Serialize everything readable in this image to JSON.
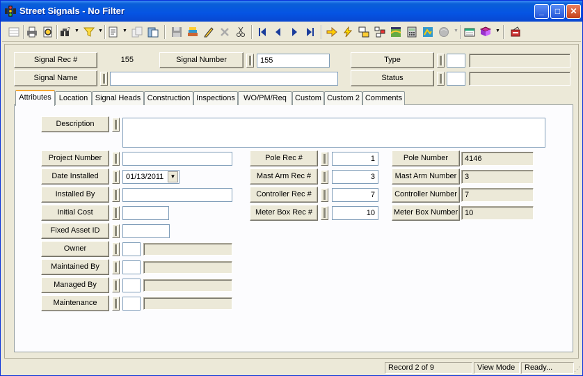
{
  "window": {
    "title": "Street Signals - No Filter",
    "controls": [
      "_",
      "□",
      "✕"
    ]
  },
  "toolbar": {
    "buttons": [
      "grid-icon",
      "print-icon",
      "print-preview-icon",
      "query-icon",
      "filter-icon",
      "report-icon",
      "copy-icon",
      "paste-icon",
      "save-icon",
      "attach-icon",
      "edit-icon",
      "delete-icon",
      "cut-icon",
      "first-record-icon",
      "previous-record-icon",
      "next-record-icon",
      "last-record-icon",
      "goto-icon",
      "lightning-icon",
      "link-icon",
      "tree-icon",
      "map-icon",
      "calculator-icon",
      "gis-icon",
      "globe-icon",
      "calendar-icon",
      "books-icon",
      "exit-icon"
    ]
  },
  "header": {
    "signal_rec_label": "Signal Rec #",
    "signal_rec_value": "155",
    "signal_number_label": "Signal Number",
    "signal_number_value": "155",
    "type_label": "Type",
    "type_code": "",
    "type_desc": "",
    "signal_name_label": "Signal Name",
    "signal_name_value": "",
    "status_label": "Status",
    "status_code": "",
    "status_desc": ""
  },
  "tabs": [
    {
      "label": "Attributes",
      "active": true
    },
    {
      "label": "Location"
    },
    {
      "label": "Signal Heads"
    },
    {
      "label": "Construction"
    },
    {
      "label": "Inspections"
    },
    {
      "label": "WO/PM/Req"
    },
    {
      "label": "Custom"
    },
    {
      "label": "Custom 2"
    },
    {
      "label": "Comments"
    }
  ],
  "attributes": {
    "description_label": "Description",
    "description_value": "",
    "project_number_label": "Project Number",
    "project_number_value": "",
    "date_installed_label": "Date Installed",
    "date_installed_value": "01/13/2011",
    "installed_by_label": "Installed By",
    "installed_by_value": "",
    "initial_cost_label": "Initial Cost",
    "initial_cost_value": "",
    "fixed_asset_label": "Fixed Asset ID",
    "fixed_asset_value": "",
    "owner_label": "Owner",
    "maintained_by_label": "Maintained By",
    "managed_by_label": "Managed By",
    "maintenance_label": "Maintenance",
    "pole_rec_label": "Pole Rec #",
    "pole_rec_value": "1",
    "pole_number_label": "Pole Number",
    "pole_number_value": "4146",
    "mast_arm_rec_label": "Mast Arm Rec #",
    "mast_arm_rec_value": "3",
    "mast_arm_number_label": "Mast Arm Number",
    "mast_arm_number_value": "3",
    "controller_rec_label": "Controller Rec #",
    "controller_rec_value": "7",
    "controller_number_label": "Controller Number",
    "controller_number_value": "7",
    "meter_box_rec_label": "Meter Box Rec #",
    "meter_box_rec_value": "10",
    "meter_box_number_label": "Meter Box Number",
    "meter_box_number_value": "10"
  },
  "status": {
    "record": "Record 2 of 9",
    "mode": "View Mode",
    "state": "Ready..."
  }
}
